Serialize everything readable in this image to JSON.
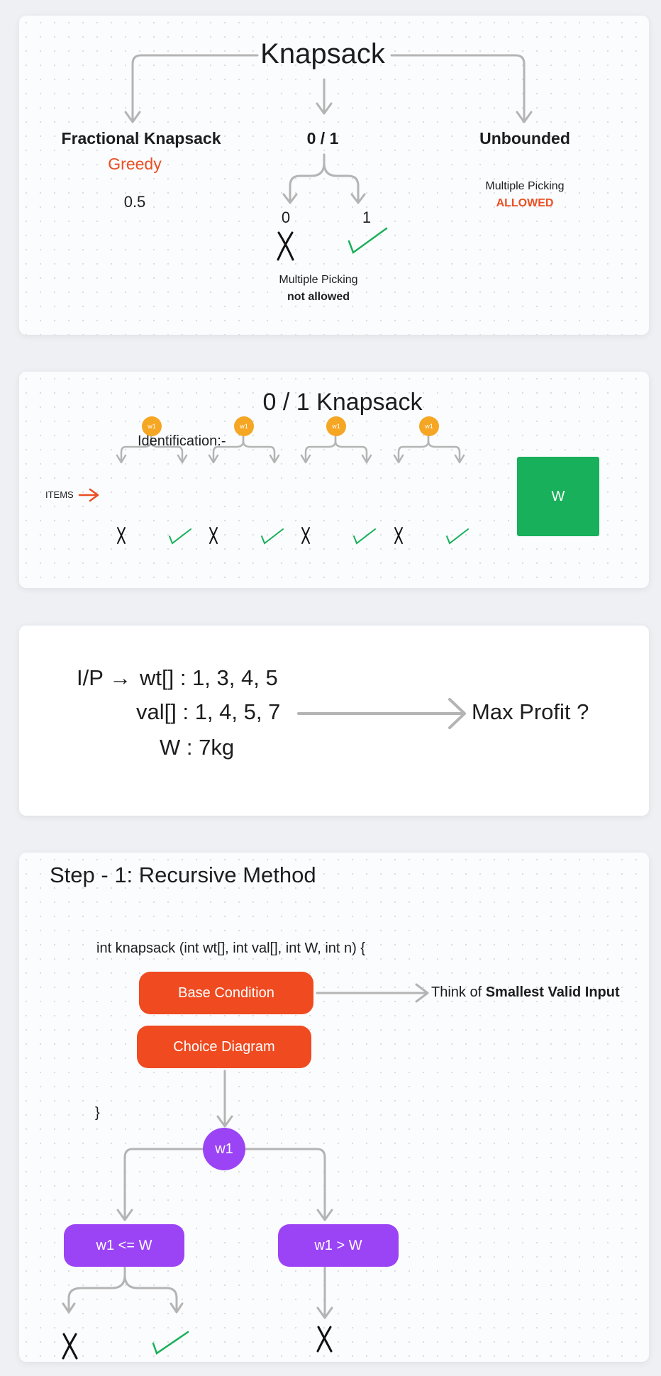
{
  "card1": {
    "title": "Knapsack",
    "fractional": {
      "title": "Fractional Knapsack",
      "approach": "Greedy",
      "example": "0.5"
    },
    "zero_one": {
      "title": "0 / 1",
      "left": "0",
      "right": "1",
      "note_line1": "Multiple Picking",
      "note_line2": "not allowed"
    },
    "unbounded": {
      "title": "Unbounded",
      "note_line1": "Multiple Picking",
      "note_line2": "ALLOWED"
    }
  },
  "card2": {
    "title": "0 / 1 Knapsack",
    "identification": "Identification:-",
    "items_label": "ITEMS",
    "item_label": "w1",
    "capacity_label": "W"
  },
  "card3": {
    "ip_prefix": "I/P →",
    "wt": "wt[] : 1, 3, 4, 5",
    "val": "val[] : 1, 4, 5, 7",
    "w": "W :  7kg",
    "output": "Max Profit ?"
  },
  "card4": {
    "title": "Step - 1: Recursive Method",
    "signature": "int knapsack (int wt[], int val[], int W, int n) {",
    "base_condition": "Base Condition",
    "choice_diagram": "Choice Diagram",
    "closing_brace": "}",
    "hint_prefix": "Think of ",
    "hint_bold": "Smallest Valid Input",
    "node": "w1",
    "left_branch": "w1 <= W",
    "right_branch": "w1 > W"
  },
  "colors": {
    "accent_orange": "#ef4a20",
    "accent_purple": "#9b44f5",
    "check_green": "#18b05a",
    "item_orange": "#f5a623",
    "arrow_gray": "#b4b4b4"
  }
}
